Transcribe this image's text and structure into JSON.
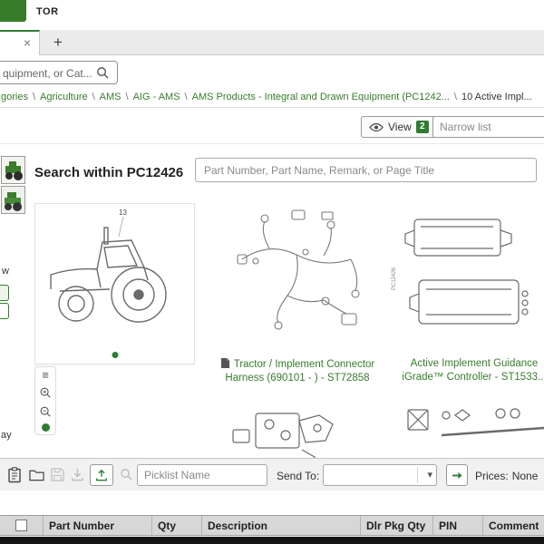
{
  "colors": {
    "accent_green": "#367c2b",
    "badge_green": "#2e7d32"
  },
  "header": {
    "logo_fragment": "TOR"
  },
  "tab_bar": {
    "tab_close_icon": "×",
    "new_tab_icon": "+"
  },
  "global_search": {
    "value_fragment": "quipment, or Cat..."
  },
  "breadcrumb": {
    "separator": "\\",
    "links": [
      "gories",
      "Agriculture",
      "AMS",
      "AIG - AMS",
      "AMS Products - Integral and Drawn Equipment (PC1242..."
    ],
    "current": "10 Active Impl..."
  },
  "view_toolbar": {
    "view_label": "View",
    "view_count": "2",
    "narrow_list_placeholder": "Narrow list"
  },
  "pc_search": {
    "heading": "Search within PC12426",
    "placeholder": "Part Number, Part Name, Remark, or Page Title"
  },
  "left_panel": {
    "fragment_1": "w",
    "fragment_2": "ay"
  },
  "preview_card": {
    "marker": "13"
  },
  "cards": [
    {
      "title_line1": "Tractor / Implement Connector",
      "title_line2": "Harness (690101 - ) - ST72858"
    },
    {
      "title_line1": "Active Implement Guidance",
      "title_line2": "iGrade™ Controller - ST1533...",
      "side_label": "PC12426"
    }
  ],
  "zoom_controls": {
    "menu_icon": "≡"
  },
  "picklist_bar": {
    "picklist_placeholder": "Picklist Name",
    "send_to_label": "Send To:",
    "prices_label": "Prices:",
    "prices_value": "None",
    "dropdown_chevron": "▾"
  },
  "parts_table": {
    "headers": [
      "Part Number",
      "Qty",
      "Description",
      "Dlr Pkg Qty",
      "PIN",
      "Comment"
    ]
  },
  "icons": {
    "search": "magnifier-glyph",
    "view_eye": "eye-outline",
    "document": "solid-page",
    "clipboard": "clipboard-outline",
    "folder": "folder-outline",
    "save": "floppy-outline-disabled",
    "download": "arrow-down-tray-disabled",
    "upload": "arrow-up-tray-green",
    "zoom_in": "magnifier-plus",
    "zoom_out": "magnifier-minus",
    "menu": "three-lines",
    "page_indicator": "green-dot",
    "chevron_down": "▾",
    "send_arrow": "green-right-arrow",
    "close": "×",
    "plus": "+"
  }
}
